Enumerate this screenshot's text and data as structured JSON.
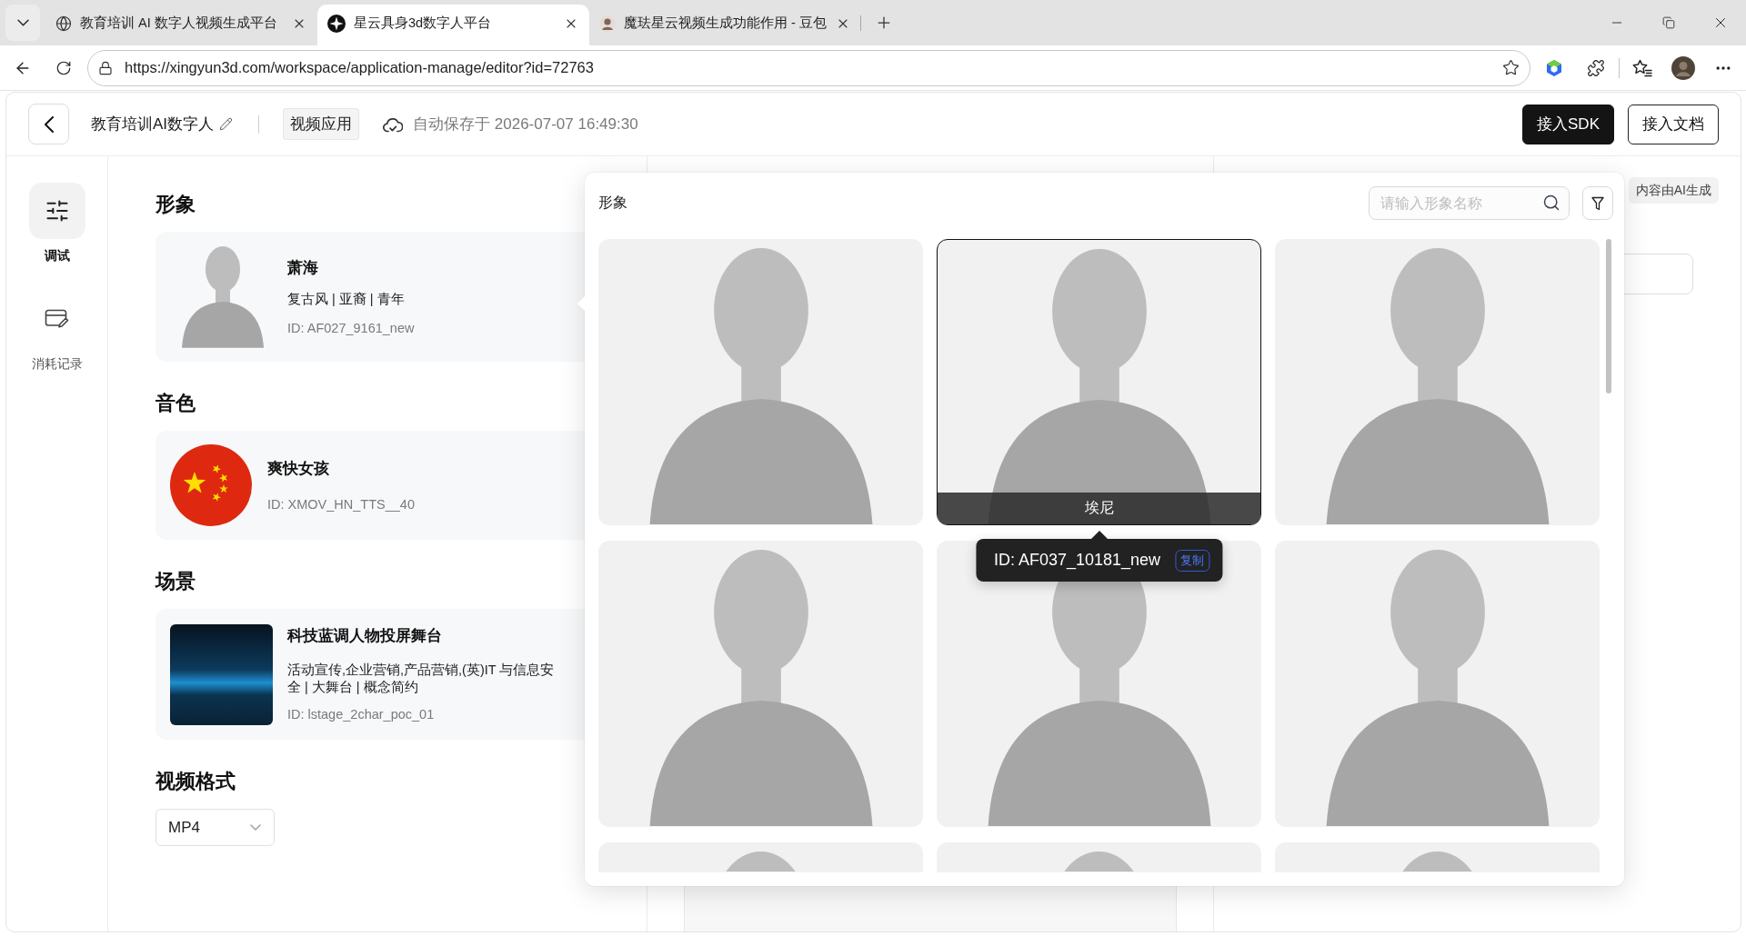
{
  "browser": {
    "tabs": [
      {
        "kind": "globe",
        "title": "教育培训 AI 数字人视频生成平台",
        "selected": false
      },
      {
        "kind": "logo",
        "title": "星云具身3d数字人平台",
        "selected": true
      },
      {
        "kind": "avatar",
        "title": "魔珐星云视频生成功能作用 - 豆包",
        "selected": false
      }
    ],
    "url": "https://xingyun3d.com/workspace/application-manage/editor?id=72763"
  },
  "header": {
    "title": "教育培训AI数字人",
    "tag": "视频应用",
    "autosave": "自动保存于 2026-07-07 16:49:30",
    "buttons": [
      {
        "label": "接入SDK",
        "primary": true
      },
      {
        "label": "接入文档",
        "primary": false
      }
    ]
  },
  "sidebar": {
    "items": [
      {
        "kind": "debug",
        "label": "调试",
        "selected": true
      },
      {
        "kind": "usage",
        "label": "消耗记录",
        "selected": false
      }
    ]
  },
  "settings": {
    "sections": [
      {
        "kind": "avatar",
        "heading": "形象",
        "name": "萧海",
        "tags": "复古风 | 亚裔 | 青年",
        "id": "ID: AF027_9161_new"
      },
      {
        "kind": "voice",
        "heading": "音色",
        "name": "爽快女孩",
        "id": "ID: XMOV_HN_TTS__40"
      },
      {
        "kind": "scene",
        "heading": "场景",
        "name": "科技蓝调人物投屏舞台",
        "description": "活动宣传,企业营销,产品营销,(英)IT 与信息安全 | 大舞台 | 概念简约",
        "id": "ID: lstage_2char_poc_01"
      },
      {
        "kind": "format",
        "heading": "视频格式",
        "value": "MP4"
      }
    ]
  },
  "right_panel": {
    "badge": "内容由AI生成"
  },
  "avatar_picker": {
    "title": "形象",
    "search": {
      "placeholder": "请输入形象名称"
    },
    "items": [
      {
        "hovered": false
      },
      {
        "hovered": true,
        "name": "埃尼",
        "tooltip": {
          "id": "ID: AF037_10181_new",
          "action": "复制"
        }
      },
      {
        "hovered": false
      },
      {
        "hovered": false
      },
      {
        "hovered": false
      },
      {
        "hovered": false
      },
      {
        "hovered": false
      },
      {
        "hovered": false
      },
      {
        "hovered": false
      }
    ]
  }
}
